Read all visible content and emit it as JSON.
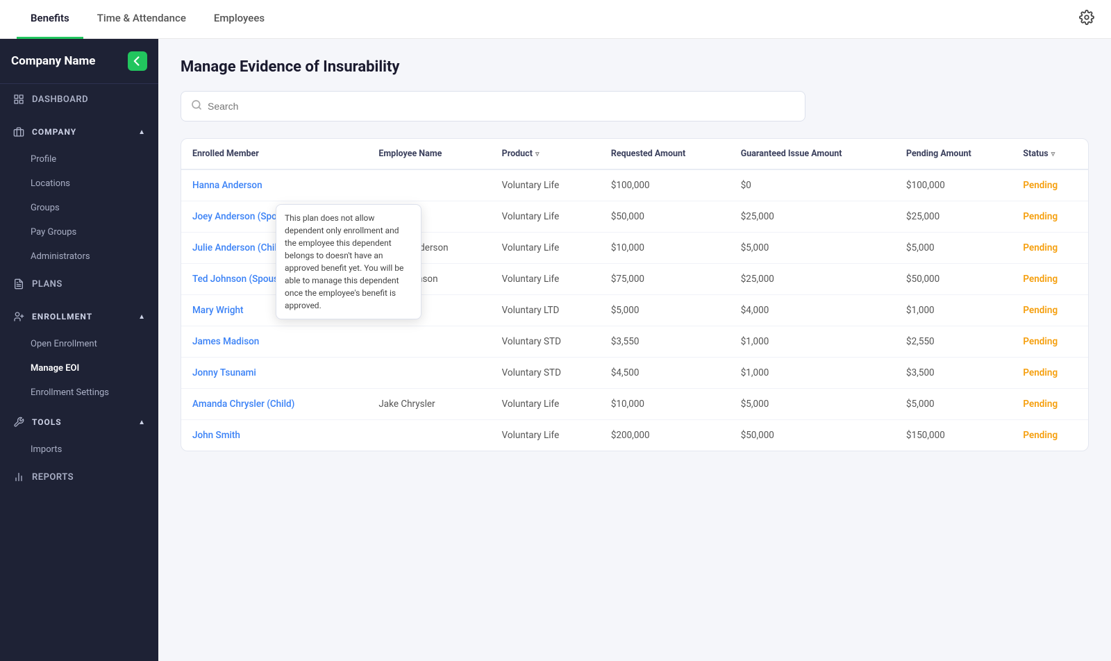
{
  "topNav": {
    "tabs": [
      {
        "label": "Benefits",
        "active": true
      },
      {
        "label": "Time & Attendance",
        "active": false
      },
      {
        "label": "Employees",
        "active": false
      }
    ],
    "gear_label": "settings"
  },
  "sidebar": {
    "company_name": "Company Name",
    "collapse_btn_label": "collapse",
    "nav": [
      {
        "id": "dashboard",
        "label": "DASHBOARD",
        "type": "item",
        "icon": "dashboard-icon"
      },
      {
        "id": "company",
        "label": "COMPANY",
        "type": "section",
        "icon": "company-icon",
        "expanded": true
      },
      {
        "id": "profile",
        "label": "Profile",
        "type": "sub"
      },
      {
        "id": "locations",
        "label": "Locations",
        "type": "sub"
      },
      {
        "id": "groups",
        "label": "Groups",
        "type": "sub"
      },
      {
        "id": "pay-groups",
        "label": "Pay Groups",
        "type": "sub"
      },
      {
        "id": "administrators",
        "label": "Administrators",
        "type": "sub"
      },
      {
        "id": "plans",
        "label": "PLANS",
        "type": "item",
        "icon": "plans-icon"
      },
      {
        "id": "enrollment",
        "label": "ENROLLMENT",
        "type": "section",
        "icon": "enrollment-icon",
        "expanded": true
      },
      {
        "id": "open-enrollment",
        "label": "Open Enrollment",
        "type": "sub"
      },
      {
        "id": "manage-eoi",
        "label": "Manage EOI",
        "type": "sub",
        "active": true
      },
      {
        "id": "enrollment-settings",
        "label": "Enrollment Settings",
        "type": "sub"
      },
      {
        "id": "tools",
        "label": "TOOLS",
        "type": "section",
        "icon": "tools-icon",
        "expanded": true
      },
      {
        "id": "imports",
        "label": "Imports",
        "type": "sub"
      },
      {
        "id": "reports",
        "label": "REPORTS",
        "type": "item",
        "icon": "reports-icon"
      }
    ]
  },
  "page": {
    "title": "Manage Evidence of Insurability",
    "search_placeholder": "Search"
  },
  "table": {
    "columns": [
      {
        "id": "enrolled_member",
        "label": "Enrolled Member",
        "filterable": false
      },
      {
        "id": "employee_name",
        "label": "Employee Name",
        "filterable": false
      },
      {
        "id": "product",
        "label": "Product",
        "filterable": true
      },
      {
        "id": "requested_amount",
        "label": "Requested Amount",
        "filterable": false
      },
      {
        "id": "guaranteed_issue_amount",
        "label": "Guaranteed Issue Amount",
        "filterable": false
      },
      {
        "id": "pending_amount",
        "label": "Pending Amount",
        "filterable": false
      },
      {
        "id": "status",
        "label": "Status",
        "filterable": true
      }
    ],
    "rows": [
      {
        "enrolled_member": "Hanna Anderson",
        "employee_name": "",
        "product": "Voluntary Life",
        "requested_amount": "$100,000",
        "guaranteed_issue_amount": "$0",
        "pending_amount": "$100,000",
        "status": "Pending",
        "has_tooltip": false
      },
      {
        "enrolled_member": "Joey Anderson (Spouse)",
        "employee_name": "",
        "product": "Voluntary Life",
        "requested_amount": "$50,000",
        "guaranteed_issue_amount": "$25,000",
        "pending_amount": "$25,000",
        "status": "Pending",
        "has_tooltip": true,
        "tooltip_text": "This plan does not allow dependent only enrollment and the employee this dependent belongs to doesn't have an approved benefit yet. You will be able to manage this dependent once the employee's benefit is approved."
      },
      {
        "enrolled_member": "Julie Anderson (Child)",
        "employee_name": "Hanna Anderson",
        "product": "Voluntary Life",
        "requested_amount": "$10,000",
        "guaranteed_issue_amount": "$5,000",
        "pending_amount": "$5,000",
        "status": "Pending",
        "has_tooltip": true,
        "tooltip_text": ""
      },
      {
        "enrolled_member": "Ted Johnson (Spouse)",
        "employee_name": "Jada Johnson",
        "product": "Voluntary Life",
        "requested_amount": "$75,000",
        "guaranteed_issue_amount": "$25,000",
        "pending_amount": "$50,000",
        "status": "Pending",
        "has_tooltip": false
      },
      {
        "enrolled_member": "Mary Wright",
        "employee_name": "",
        "product": "Voluntary LTD",
        "requested_amount": "$5,000",
        "guaranteed_issue_amount": "$4,000",
        "pending_amount": "$1,000",
        "status": "Pending",
        "has_tooltip": false
      },
      {
        "enrolled_member": "James Madison",
        "employee_name": "",
        "product": "Voluntary STD",
        "requested_amount": "$3,550",
        "guaranteed_issue_amount": "$1,000",
        "pending_amount": "$2,550",
        "status": "Pending",
        "has_tooltip": false
      },
      {
        "enrolled_member": "Jonny Tsunami",
        "employee_name": "",
        "product": "Voluntary STD",
        "requested_amount": "$4,500",
        "guaranteed_issue_amount": "$1,000",
        "pending_amount": "$3,500",
        "status": "Pending",
        "has_tooltip": false
      },
      {
        "enrolled_member": "Amanda Chrysler (Child)",
        "employee_name": "Jake Chrysler",
        "product": "Voluntary Life",
        "requested_amount": "$10,000",
        "guaranteed_issue_amount": "$5,000",
        "pending_amount": "$5,000",
        "status": "Pending",
        "has_tooltip": false
      },
      {
        "enrolled_member": "John Smith",
        "employee_name": "",
        "product": "Voluntary Life",
        "requested_amount": "$200,000",
        "guaranteed_issue_amount": "$50,000",
        "pending_amount": "$150,000",
        "status": "Pending",
        "has_tooltip": false
      }
    ]
  }
}
